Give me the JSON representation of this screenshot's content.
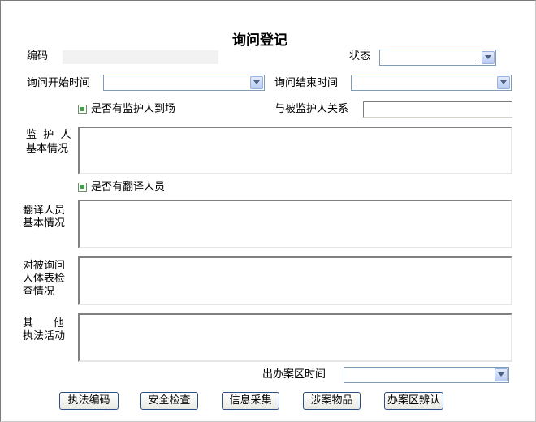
{
  "title": "询问登记",
  "fields": {
    "code_label": "编码",
    "status_label": "状态",
    "status_value": "",
    "start_time_label": "询问开始时间",
    "end_time_label": "询问结束时间",
    "guardian_present_label": "是否有监护人到场",
    "guardian_relation_label": "与被监护人关系",
    "guardian_info_label_1": "监  护  人",
    "guardian_info_label_2": "基本情况",
    "translator_present_label": "是否有翻译人员",
    "translator_info_label_1": "翻译人员",
    "translator_info_label_2": "基本情况",
    "body_check_label_1": "对被询问",
    "body_check_label_2": "人体表检",
    "body_check_label_3": "查情况",
    "other_label_1": "其      他",
    "other_label_2": "执法活动",
    "exit_time_label": "出办案区时间"
  },
  "buttons": {
    "enforcement_code": "执法编码",
    "safety_check": "安全检查",
    "info_collect": "信息采集",
    "case_items": "涉案物品",
    "case_area_identify": "办案区辨认"
  },
  "colors": {
    "checkbox_fill": "#3fa33f",
    "button_border": "#2c4f86",
    "combo_border": "#7f9db9"
  }
}
